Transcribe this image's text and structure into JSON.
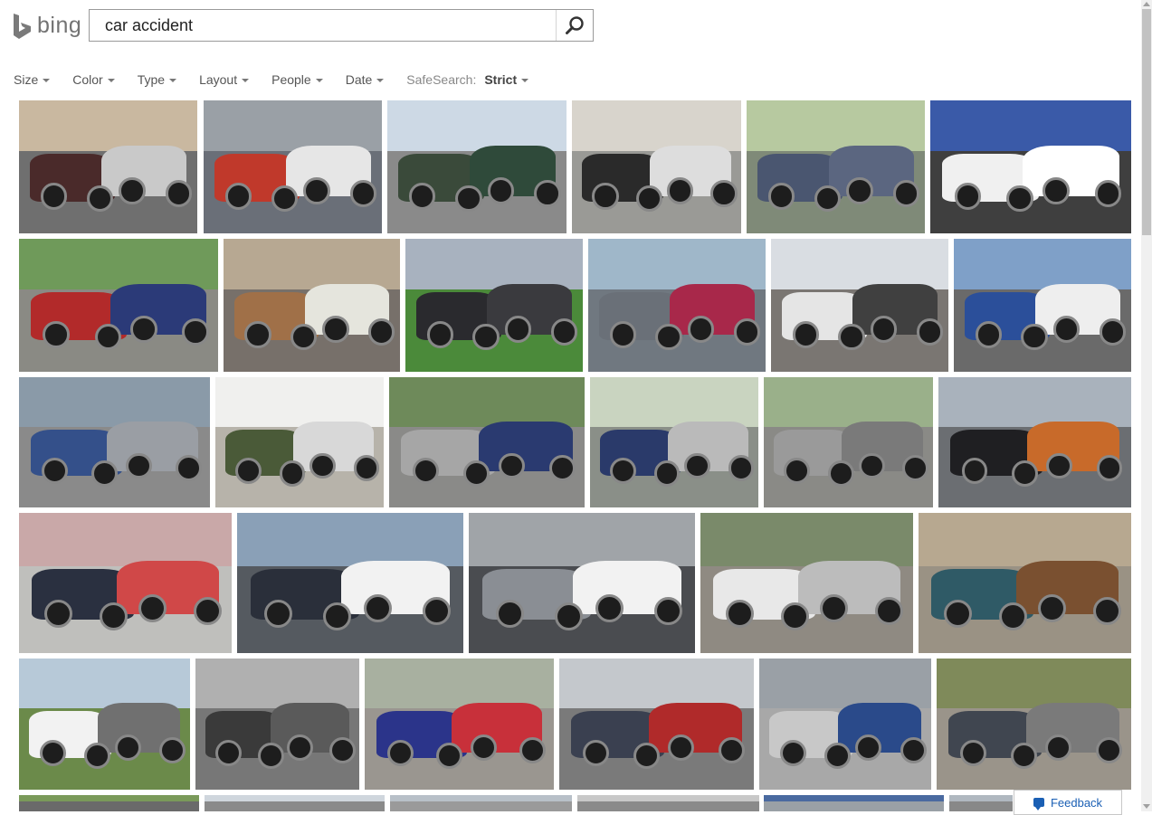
{
  "header": {
    "logo_text": "bing",
    "search": {
      "value": "car accident",
      "placeholder": ""
    }
  },
  "filters": {
    "items": [
      {
        "label": "Size"
      },
      {
        "label": "Color"
      },
      {
        "label": "Type"
      },
      {
        "label": "Layout"
      },
      {
        "label": "People"
      },
      {
        "label": "Date"
      }
    ],
    "safesearch_label": "SafeSearch:",
    "safesearch_value": "Strict"
  },
  "feedback_label": "Feedback",
  "colors": {
    "brand_gray": "#737373",
    "link_blue": "#1a5fb4",
    "scrollbar": "#c2c2c2"
  },
  "icons": {
    "logo": "bing-logo-icon",
    "search": "search-icon",
    "feedback": "feedback-chat-icon"
  },
  "results": {
    "rows": [
      {
        "images": [
          {
            "alt": "car accident image 1",
            "sky": "#c9b8a0",
            "ground": "#6f6f6f",
            "car1": "#4a2a2a",
            "car2": "#c9c9c9"
          },
          {
            "alt": "car accident image 2",
            "sky": "#9aa0a6",
            "ground": "#6a6f78",
            "car1": "#c0392b",
            "car2": "#e6e6e6"
          },
          {
            "alt": "car accident image 3",
            "sky": "#cdd9e5",
            "ground": "#8a8a8a",
            "car1": "#3a4a3a",
            "car2": "#2f4a3a"
          },
          {
            "alt": "car accident image 4",
            "sky": "#d8d4cc",
            "ground": "#9a9a96",
            "car1": "#2a2a2a",
            "car2": "#ddd"
          },
          {
            "alt": "car accident image 5",
            "sky": "#b7c9a0",
            "ground": "#7f8a78",
            "car1": "#4a5670",
            "car2": "#5b6680"
          },
          {
            "alt": "car accident image 6",
            "sky": "#3a5aa8",
            "ground": "#3f3f3f",
            "car1": "#f0f0f0",
            "car2": "#ffffff"
          }
        ]
      },
      {
        "images": [
          {
            "alt": "car accident image 7",
            "sky": "#6f9a5a",
            "ground": "#8a8a84",
            "car1": "#b22a2a",
            "car2": "#2b3a78"
          },
          {
            "alt": "car accident image 8",
            "sky": "#b7a892",
            "ground": "#77706a",
            "car1": "#a07048",
            "car2": "#e5e5dd"
          },
          {
            "alt": "car accident image 9",
            "sky": "#a8b2bf",
            "ground": "#4b8a3a",
            "car1": "#2a2a2e",
            "car2": "#3a3a3e"
          },
          {
            "alt": "car accident image 10",
            "sky": "#9fb7c9",
            "ground": "#707880",
            "car1": "#6a7078",
            "car2": "#a8284a"
          },
          {
            "alt": "car accident image 11",
            "sky": "#d9dde2",
            "ground": "#7a7672",
            "car1": "#e5e5e5",
            "car2": "#404040"
          },
          {
            "alt": "car accident image 12",
            "sky": "#7fa0c8",
            "ground": "#6a6a6a",
            "car1": "#2b4f9a",
            "car2": "#eeeeee"
          }
        ]
      },
      {
        "images": [
          {
            "alt": "car accident image 13",
            "sky": "#8a9aa8",
            "ground": "#8a8a8a",
            "car1": "#34508a",
            "car2": "#9a9ea4"
          },
          {
            "alt": "car accident image 14",
            "sky": "#f0f0ee",
            "ground": "#b7b3aa",
            "car1": "#4a5a38",
            "car2": "#d8d8d8"
          },
          {
            "alt": "car accident image 15",
            "sky": "#6e8a5a",
            "ground": "#8a8a88",
            "car1": "#a6a6a6",
            "car2": "#2a3a70"
          },
          {
            "alt": "car accident image 16",
            "sky": "#c9d4c0",
            "ground": "#8a8f88",
            "car1": "#2a3a6a",
            "car2": "#bababa"
          },
          {
            "alt": "car accident image 17",
            "sky": "#9ab08a",
            "ground": "#8a8a86",
            "car1": "#9a9a9a",
            "car2": "#7a7a7a"
          },
          {
            "alt": "car accident image 18",
            "sky": "#a9b2bc",
            "ground": "#6b6e72",
            "car1": "#1f1f22",
            "car2": "#c86a2a"
          }
        ]
      },
      {
        "images": [
          {
            "alt": "car accident image 19",
            "sky": "#c9a8a8",
            "ground": "#bfbfbc",
            "car1": "#2a3040",
            "car2": "#d04848"
          },
          {
            "alt": "car accident image 20",
            "sky": "#8aa0b7",
            "ground": "#555a60",
            "car1": "#2a2f3a",
            "car2": "#f2f2f2"
          },
          {
            "alt": "car accident image 21",
            "sky": "#a0a4a8",
            "ground": "#4a4c50",
            "car1": "#8a8e94",
            "car2": "#f2f2f2"
          },
          {
            "alt": "car accident image 22",
            "sky": "#7a8a6a",
            "ground": "#8f8a82",
            "car1": "#e8e8e8",
            "car2": "#bcbcbc"
          },
          {
            "alt": "car accident image 23",
            "sky": "#b7a890",
            "ground": "#9a9284",
            "car1": "#2f5a66",
            "car2": "#7a5030"
          }
        ]
      },
      {
        "images": [
          {
            "alt": "car accident image 24",
            "sky": "#b7c9d8",
            "ground": "#6b8a4a",
            "car1": "#f2f2f2",
            "car2": "#707070"
          },
          {
            "alt": "car accident image 25",
            "sky": "#b0b0b0",
            "ground": "#777777",
            "car1": "#3a3a3a",
            "car2": "#5a5a5a"
          },
          {
            "alt": "car accident image 26",
            "sky": "#a8b0a0",
            "ground": "#9a9690",
            "car1": "#2b348a",
            "car2": "#c8303a"
          },
          {
            "alt": "car accident image 27",
            "sky": "#c4c8cc",
            "ground": "#7a7a7a",
            "car1": "#3a4050",
            "car2": "#b02a2a"
          },
          {
            "alt": "car accident image 28",
            "sky": "#9aa0a6",
            "ground": "#a8a8a8",
            "car1": "#c8c8c8",
            "car2": "#2a4a8a"
          },
          {
            "alt": "car accident image 29",
            "sky": "#7f8a5a",
            "ground": "#9a948a",
            "car1": "#404650",
            "car2": "#7a7a7a"
          }
        ]
      },
      {
        "images": [
          {
            "alt": "car accident image 30",
            "sky": "#7a9a5a",
            "ground": "#6a6a6a",
            "car1": "#c03030",
            "car2": "#555"
          },
          {
            "alt": "car accident image 31",
            "sky": "#cfd6dd",
            "ground": "#8a8a8a",
            "car1": "#333",
            "car2": "#666"
          },
          {
            "alt": "car accident image 32",
            "sky": "#b8c0c8",
            "ground": "#9a9a9a",
            "car1": "#d8d8d8",
            "car2": "#444"
          },
          {
            "alt": "car accident image 33",
            "sky": "#c8c8c8",
            "ground": "#8a8a8a",
            "car1": "#a0a0a0",
            "car2": "#e0e0e0"
          },
          {
            "alt": "car accident image 34",
            "sky": "#4a6aa0",
            "ground": "#9aa0a6",
            "car1": "#e6e6e6",
            "car2": "#666"
          },
          {
            "alt": "car accident image 35",
            "sky": "#b0b8c0",
            "ground": "#888",
            "car1": "#555",
            "car2": "#ccc"
          }
        ]
      }
    ]
  }
}
